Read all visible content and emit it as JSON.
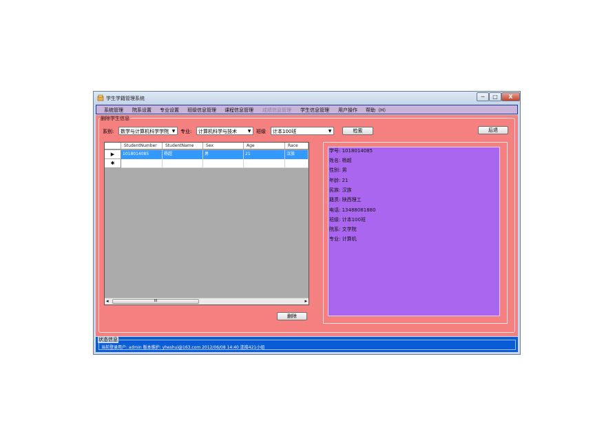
{
  "window": {
    "title": "学生学籍管理系统",
    "controls": {
      "minimize": "─",
      "maximize": "□",
      "close": "X"
    }
  },
  "menu": [
    {
      "label": "系统管理",
      "enabled": true
    },
    {
      "label": "院系设置",
      "enabled": true
    },
    {
      "label": "专业设置",
      "enabled": true
    },
    {
      "label": "班级信息管理",
      "enabled": true
    },
    {
      "label": "课程信息管理",
      "enabled": true
    },
    {
      "label": "成绩信息管理",
      "enabled": false
    },
    {
      "label": "学生信息管理",
      "enabled": true
    },
    {
      "label": "用户操作",
      "enabled": true
    },
    {
      "label": "帮助（H）",
      "enabled": true
    }
  ],
  "panel": {
    "title": "删除学生信息",
    "dept_label": "系别:",
    "dept_value": "数学与计算机科学学院",
    "major_label": "专业:",
    "major_value": "计算机科学与技术",
    "class_label": "班级",
    "class_value": "计本100班",
    "search_button": "检索",
    "back_button": "后退",
    "delete_button": "删除"
  },
  "grid": {
    "columns": [
      "StudentNumber",
      "StudentName",
      "Sex",
      "Age",
      "Race"
    ],
    "rows": [
      [
        "1018014085",
        "杨超",
        "男",
        "21",
        "汉族"
      ]
    ],
    "current_row_marker": "▶",
    "new_row_marker": "✱",
    "scroll_left": "◂",
    "scroll_right": "▸",
    "scroll_thumb_grip": "III"
  },
  "info": [
    "学号: 1018014085",
    "姓名: 杨超",
    "性别: 男",
    "年龄: 21",
    "民族: 汉族",
    "籍贯: 陕西理工",
    "电话: 13488081880",
    "班级: 计本100班",
    "院系: 文学院",
    "专业: 计算机"
  ],
  "status": {
    "title": "状态信息",
    "text": "当前登录用户: admin  版本维护: yheshui@163.com  2012/06/08  14:40      连接421小组"
  },
  "colors": {
    "panel_bg": "#f58080",
    "info_bg": "#aa66ee",
    "selection": "#3399ff",
    "status_bg": "#0a5bd6",
    "menu_bg": "#c9b4d8"
  }
}
